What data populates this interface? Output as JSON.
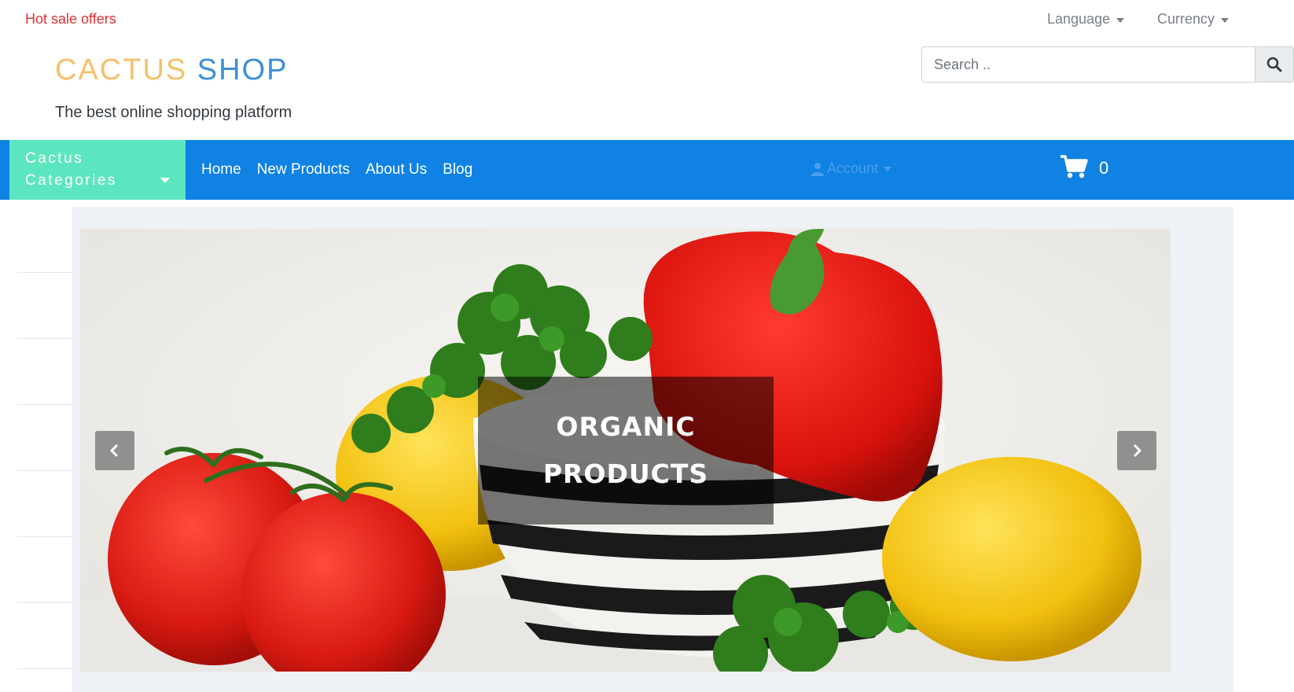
{
  "topbar": {
    "hot_sale": "Hot sale offers",
    "language": "Language",
    "currency": "Currency"
  },
  "header": {
    "logo_word1": "CACTUS",
    "logo_word2": "SHOP",
    "tagline": "The best online shopping platform",
    "search_placeholder": "Search .."
  },
  "navbar": {
    "categories_line1": "Cactus",
    "categories_line2": "Categories",
    "links": [
      "Home",
      "New Products",
      "About Us",
      "Blog"
    ],
    "account": "Account",
    "cart_count": "0"
  },
  "carousel": {
    "caption_line1": "ORGANIC",
    "caption_line2": "PRODUCTS"
  },
  "colors": {
    "navbar": "#0f82e3",
    "categories": "#5ce6c0",
    "logo_word1": "#f6c06c",
    "logo_word2": "#3d8fd8",
    "hot_sale": "#e03131"
  },
  "icons": [
    "search-icon",
    "user-icon",
    "cart-icon",
    "chevron-left-icon",
    "chevron-right-icon",
    "caret-down-icon"
  ]
}
